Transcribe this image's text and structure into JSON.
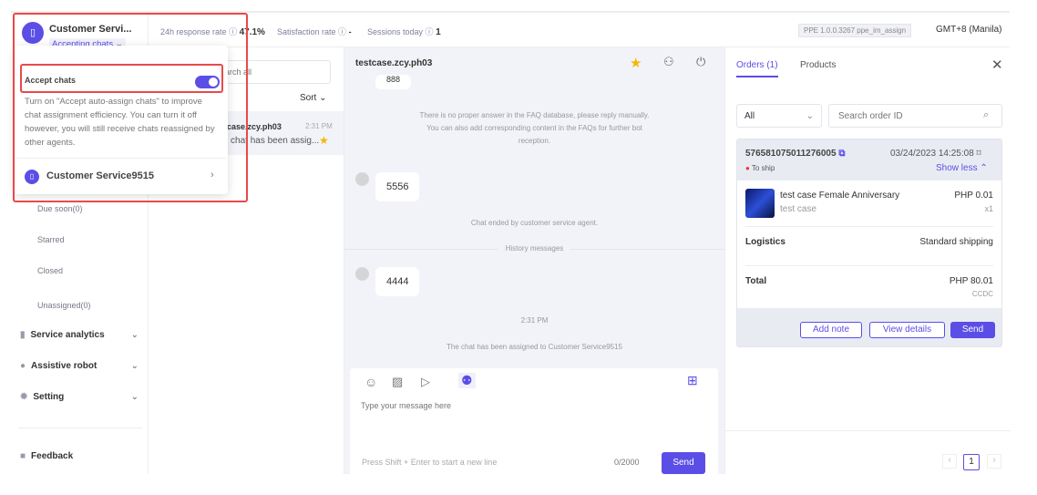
{
  "header": {
    "agent_name": "Customer Servi...",
    "status": "Accepting chats",
    "stats": [
      {
        "label": "24h response rate",
        "value": "47.1%"
      },
      {
        "label": "Satisfaction rate",
        "value": "-"
      },
      {
        "label": "Sessions today",
        "value": "1"
      }
    ],
    "version": "PPE 1.0.0.3267 ppe_im_assign",
    "timezone": "GMT+8 (Manila)"
  },
  "popup": {
    "accept_label": "Accept chats",
    "accept_on": true,
    "description": "Turn on \"Accept auto-assign chats\" to improve chat assignment efficiency. You can turn it off however, you will still receive chats reassigned by other agents.",
    "account": "Customer Service9515"
  },
  "sidebar": {
    "sub_items": [
      "Due soon(0)",
      "Starred",
      "Closed",
      "Unassigned(0)"
    ],
    "main_items": [
      "Service analytics",
      "Assistive robot",
      "Setting"
    ],
    "feedback": "Feedback"
  },
  "convlist": {
    "search_placeholder": "Search all",
    "sort": "Sort",
    "item": {
      "name": "testcase.zcy.ph03",
      "time": "2:31 PM",
      "preview": "The chat has been assig..."
    }
  },
  "chat": {
    "title": "testcase.zcy.ph03",
    "messages": {
      "partial": "888",
      "faq": "There is no proper answer in the FAQ database, please reply manually. You can also add corresponding content in the FAQs for further bot reception.",
      "m1": "5556",
      "ended": "Chat ended by customer service agent.",
      "history": "History messages",
      "m2": "4444",
      "time": "2:31 PM",
      "assigned": "The chat has been assigned to Customer Service9515"
    },
    "input_placeholder": "Type your message here",
    "hint": "Press Shift + Enter to start a new line",
    "counter": "0/2000",
    "send": "Send"
  },
  "orders": {
    "tabs": [
      "Orders (1)",
      "Products"
    ],
    "filter": "All",
    "search_placeholder": "Search order ID",
    "order_id": "576581075011276005",
    "date": "03/24/2023 14:25:08",
    "status": "To ship",
    "show_less": "Show less",
    "product_name": "test case Female Anniversary",
    "product_variant": "test case",
    "price": "PHP 0.01",
    "qty": "x1",
    "logistics_label": "Logistics",
    "logistics_value": "Standard shipping",
    "total_label": "Total",
    "total_value": "PHP 80.01",
    "payment": "CCDC",
    "add_note": "Add note",
    "view_details": "View details",
    "send": "Send",
    "page": "1"
  },
  "colors": {
    "accent": "#5b4ee6",
    "highlight": "#e84a4a",
    "star": "#f5b700"
  }
}
